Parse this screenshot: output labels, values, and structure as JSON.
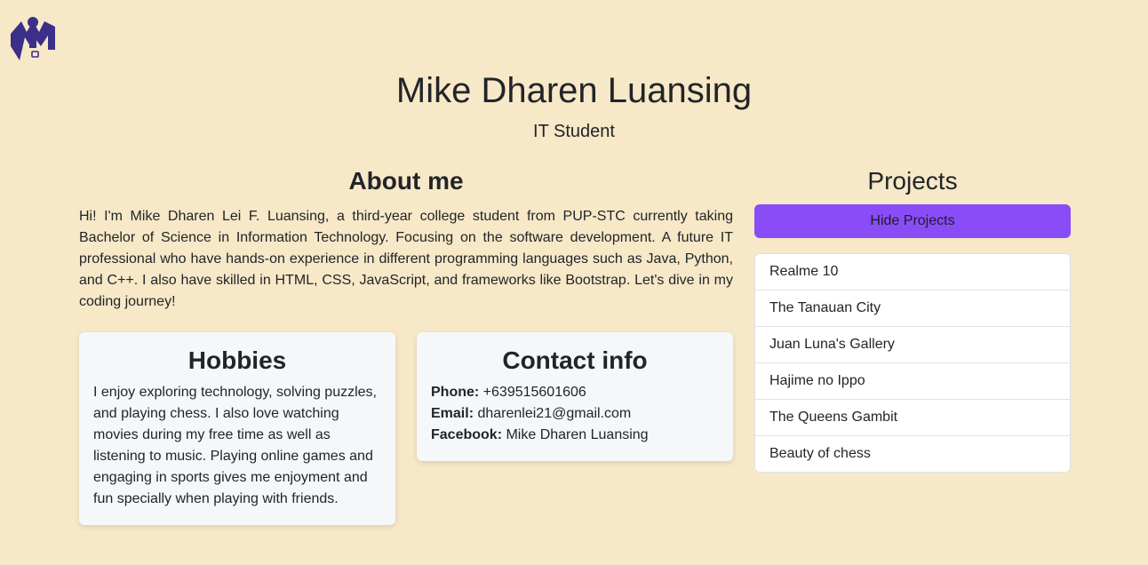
{
  "brand": {
    "logo_icon": "m-logo-icon",
    "logo_color": "#3b2f8a"
  },
  "header": {
    "name": "Mike Dharen Luansing",
    "role": "IT Student"
  },
  "about": {
    "title": "About me",
    "text": "Hi! I'm Mike Dharen Lei F. Luansing, a third-year college student from PUP-STC currently taking Bachelor of Science in Information Technology. Focusing on the software development. A future IT professional who have hands-on experience in different programming languages such as Java, Python, and C++. I also have skilled in HTML, CSS, JavaScript, and frameworks like Bootstrap. Let's dive in my coding journey!"
  },
  "hobbies": {
    "title": "Hobbies",
    "text": "I enjoy exploring technology, solving puzzles, and playing chess. I also love watching movies during my free time as well as listening to music. Playing online games and engaging in sports gives me enjoyment and fun specially when playing with friends."
  },
  "contact": {
    "title": "Contact info",
    "phone_label": "Phone:",
    "phone": "+639515601606",
    "email_label": "Email:",
    "email": "dharenlei21@gmail.com",
    "facebook_label": "Facebook:",
    "facebook": "Mike Dharen Luansing"
  },
  "projects": {
    "title": "Projects",
    "toggle_label": "Hide Projects",
    "accent": "#8a4cf7",
    "items": [
      "Realme 10",
      "The Tanauan City",
      "Juan Luna's Gallery",
      "Hajime no Ippo",
      "The Queens Gambit",
      "Beauty of chess"
    ]
  }
}
